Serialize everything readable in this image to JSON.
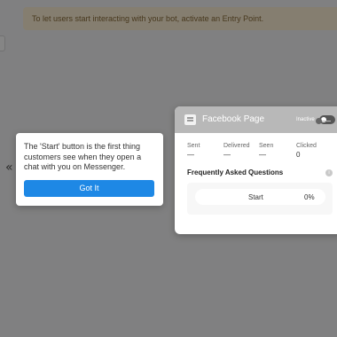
{
  "banner": {
    "text": "To let users start interacting with your bot, activate an Entry Point."
  },
  "tooltip": {
    "text": "The 'Start' button is the first thing customers see when they open a chat with you on Messenger.",
    "button_label": "Got It"
  },
  "collapse_glyph": "«",
  "entry_card": {
    "title": "Facebook Page",
    "status": "Inactive",
    "toggle_on": false,
    "stats": [
      {
        "label": "Sent",
        "value": "—"
      },
      {
        "label": "Delivered",
        "value": "—"
      },
      {
        "label": "Seen",
        "value": "—"
      },
      {
        "label": "Clicked",
        "value": "0"
      }
    ],
    "faq_title": "Frequently Asked Questions",
    "info_glyph": "i",
    "faq_items": [
      {
        "label": "Start",
        "rate": "0%"
      }
    ]
  },
  "colors": {
    "accent": "#1e88e5",
    "banner_bg": "#fff1d6",
    "header_bg": "#b8b8b8"
  }
}
